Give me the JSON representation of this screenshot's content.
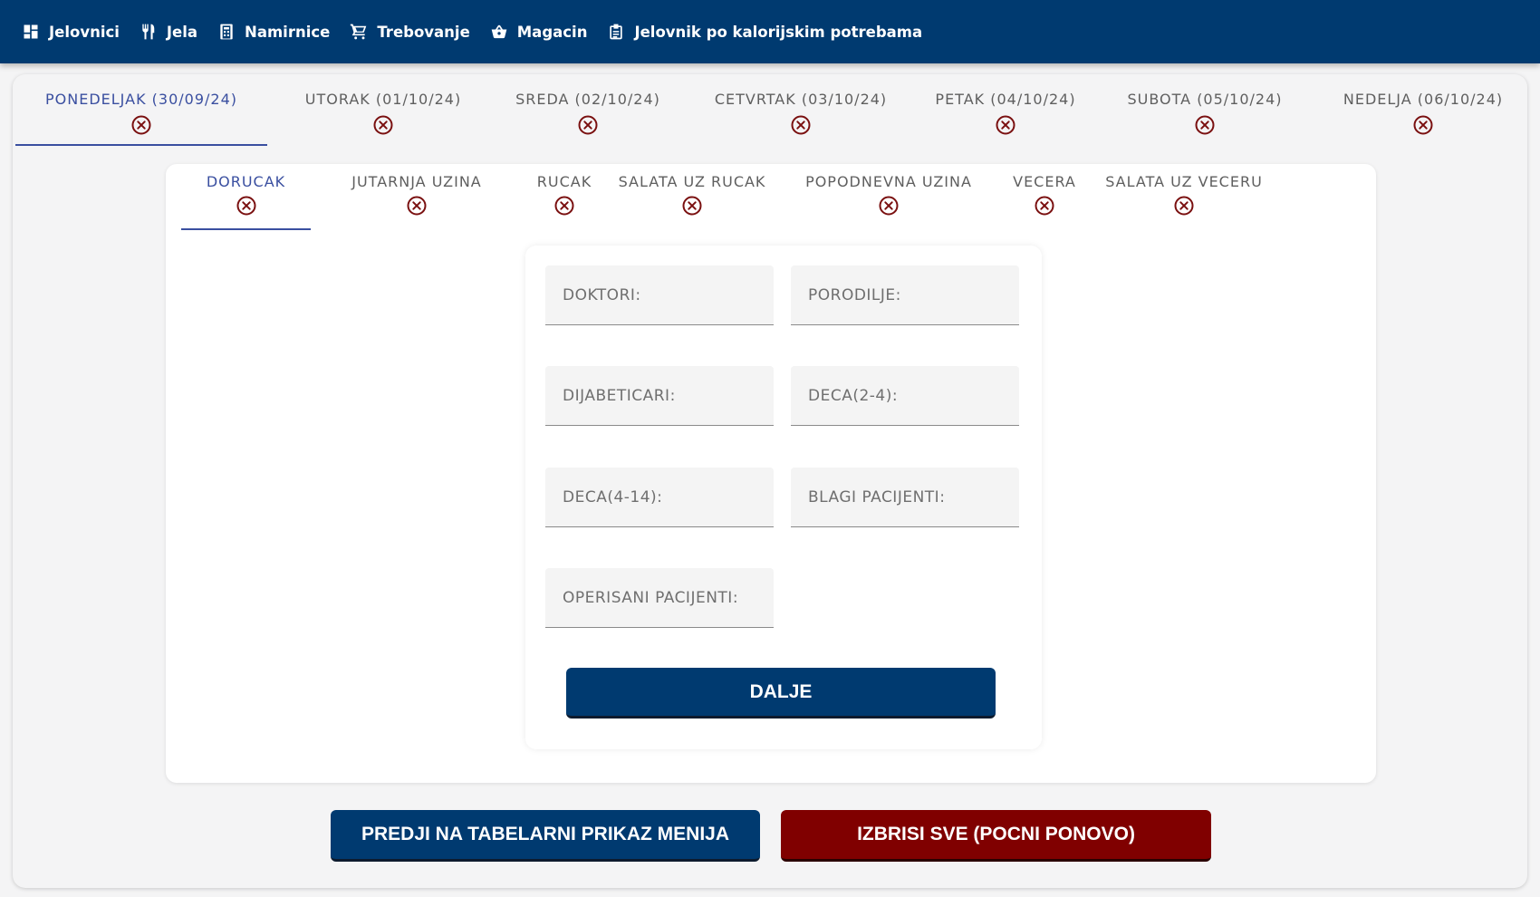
{
  "nav": {
    "items": [
      {
        "label": "Jelovnici",
        "icon": "dashboard-icon"
      },
      {
        "label": "Jela",
        "icon": "fork-knife-icon"
      },
      {
        "label": "Namirnice",
        "icon": "calculator-icon"
      },
      {
        "label": "Trebovanje",
        "icon": "cart-icon"
      },
      {
        "label": "Magacin",
        "icon": "basket-icon"
      },
      {
        "label": "Jelovnik po kalorijskim potrebama",
        "icon": "clipboard-icon"
      }
    ]
  },
  "days": {
    "tabs": [
      {
        "label": "PONEDELJAK (30/09/24)",
        "active": true
      },
      {
        "label": "UTORAK (01/10/24)"
      },
      {
        "label": "SREDA (02/10/24)"
      },
      {
        "label": "CETVRTAK (03/10/24)"
      },
      {
        "label": "PETAK (04/10/24)"
      },
      {
        "label": "SUBOTA (05/10/24)"
      },
      {
        "label": "NEDELJA (06/10/24)"
      }
    ]
  },
  "meals": {
    "tabs": [
      {
        "label": "DORUCAK",
        "active": true
      },
      {
        "label": "JUTARNJA UZINA"
      },
      {
        "label": "RUCAK"
      },
      {
        "label": "SALATA UZ RUCAK"
      },
      {
        "label": "POPODNEVNA UZINA"
      },
      {
        "label": "VECERA"
      },
      {
        "label": "SALATA UZ VECERU"
      }
    ]
  },
  "form": {
    "fields": [
      {
        "placeholder": "DOKTORI:",
        "value": ""
      },
      {
        "placeholder": "PORODILJE:",
        "value": ""
      },
      {
        "placeholder": "DIJABETICARI:",
        "value": ""
      },
      {
        "placeholder": "DECA(2-4):",
        "value": ""
      },
      {
        "placeholder": "DECA(4-14):",
        "value": ""
      },
      {
        "placeholder": "BLAGI PACIJENTI:",
        "value": ""
      },
      {
        "placeholder": "OPERISANI PACIJENTI:",
        "value": ""
      }
    ],
    "next_label": "DALJE"
  },
  "actions": {
    "table_view_label": "PREDJI NA TABELARNI PRIKAZ MENIJA",
    "delete_all_label": "IZBRISI SVE (POCNI PONOVO)"
  },
  "colors": {
    "primary": "#003a70",
    "danger": "#800000",
    "active_tab": "#3a4fa0",
    "close_icon": "#7a1010"
  }
}
